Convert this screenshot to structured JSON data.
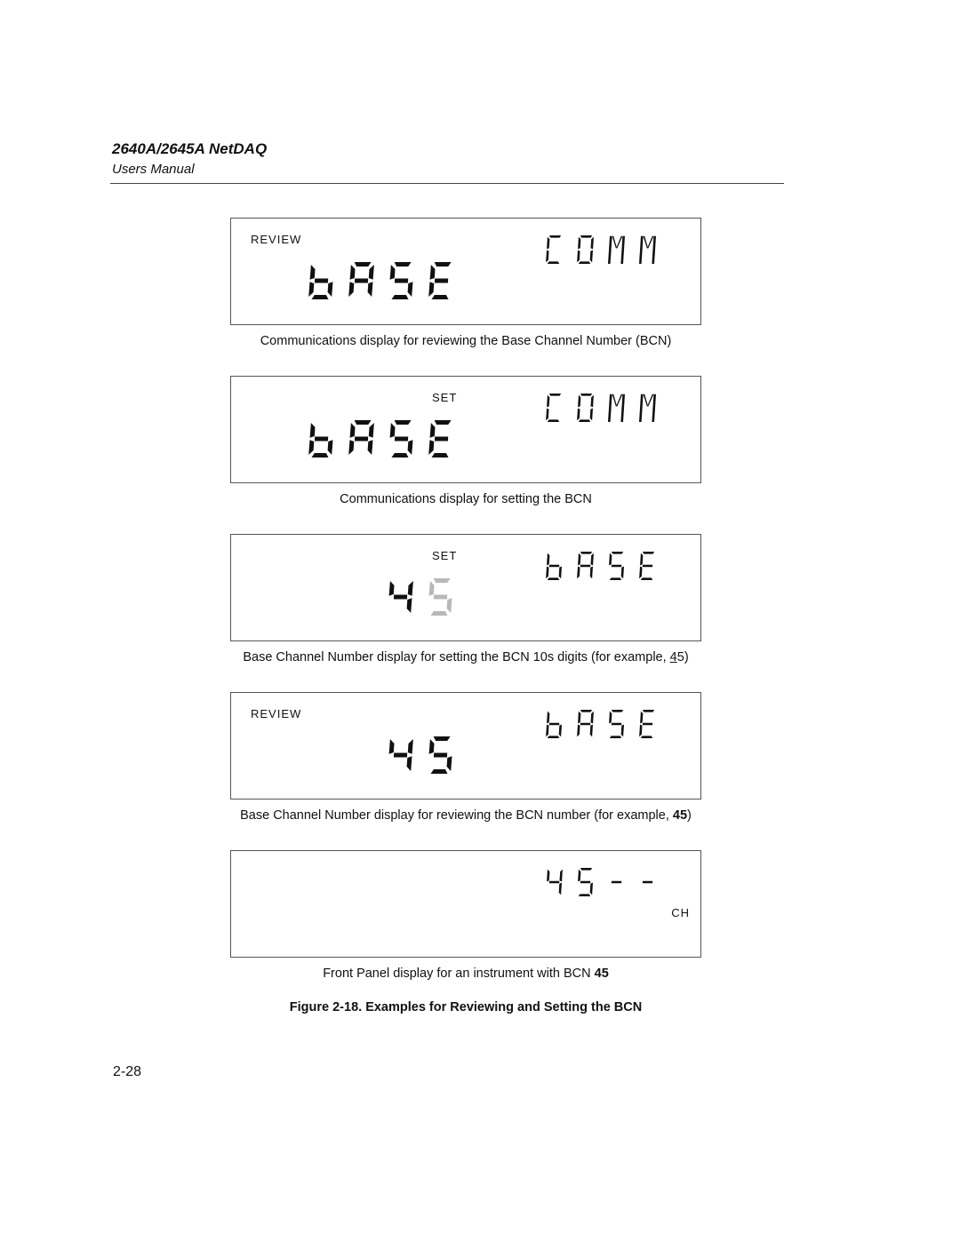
{
  "header": {
    "title": "2640A/2645A NetDAQ",
    "subtitle": "Users Manual"
  },
  "panels": [
    {
      "annunciator": "REVIEW",
      "annunciator_pos": "left",
      "main_digits": "bASE",
      "aux_digits": "COMM",
      "caption_parts": [
        {
          "text": "Communications display for reviewing the Base Channel Number (BCN)",
          "style": "normal"
        }
      ]
    },
    {
      "annunciator": "SET",
      "annunciator_pos": "center",
      "main_digits": "bASE",
      "aux_digits": "COMM",
      "caption_parts": [
        {
          "text": "Communications display for setting the BCN",
          "style": "normal"
        }
      ]
    },
    {
      "annunciator": "SET",
      "annunciator_pos": "center",
      "main_digits": "45",
      "main_dimmed_index": 1,
      "aux_digits": "bASE",
      "caption_parts": [
        {
          "text": "Base Channel Number display for setting the BCN 10s digits (for example, ",
          "style": "normal"
        },
        {
          "text": "4",
          "style": "underline"
        },
        {
          "text": "5)",
          "style": "normal"
        }
      ]
    },
    {
      "annunciator": "REVIEW",
      "annunciator_pos": "left",
      "main_digits": "45",
      "aux_digits": "bASE",
      "caption_parts": [
        {
          "text": "Base Channel Number display for reviewing the BCN number (for example, ",
          "style": "normal"
        },
        {
          "text": "45",
          "style": "bold"
        },
        {
          "text": ")",
          "style": "normal"
        }
      ]
    },
    {
      "annunciator": "CH",
      "annunciator_pos": "bottom-right",
      "main_digits": "",
      "aux_digits": "45--",
      "caption_parts": [
        {
          "text": "Front Panel display for an instrument with BCN ",
          "style": "normal"
        },
        {
          "text": "45",
          "style": "bold"
        }
      ]
    }
  ],
  "figure_title": "Figure 2-18. Examples for Reviewing and Setting the BCN",
  "page_number": "2-28",
  "colors": {
    "segment_on": "#111111",
    "segment_dim": "#b8b8b8"
  }
}
